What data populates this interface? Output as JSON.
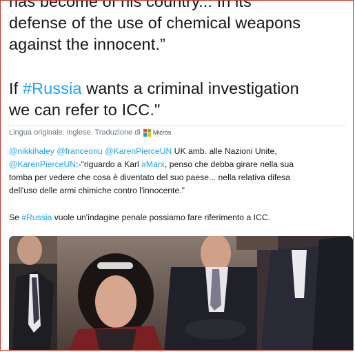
{
  "tweet": {
    "cut_line": "has become of his country... In its",
    "line1": "defense of the use of chemical weapons",
    "line2": "against the innocent.”",
    "line3_prefix": "If ",
    "line3_hashtag": "#Russia",
    "line3_suffix": " wants a criminal investigation",
    "line4": "we can refer to ICC.\""
  },
  "translation": {
    "label": "Lingua originale: inglese. Traduzione di",
    "provider": "Micros",
    "logo_colors": [
      "#f25022",
      "#7fba00",
      "#00a4ef",
      "#ffb900"
    ],
    "line1_mentions": "@nikkihaley @franceonu @KarenPierceUN",
    "line1_text": " UK amb. alle Nazioni Unite,",
    "line2_mention": "@KarenPierceUN",
    "line2_text_a": ":-\"riguardo a Karl ",
    "line2_hashtag": "#Marx",
    "line2_text_b": ", penso che debba girare nella sua",
    "line3": "tomba per vedere che cosa è diventato del suo paese... nella relativa difesa",
    "line4": "dell'uso delle armi chimiche contro l'innocente.\"",
    "line5_prefix": "Se ",
    "line5_hashtag": "#Russia",
    "line5_suffix": " vuole un'indagine penale possiamo fare riferimento a ICC."
  },
  "colors": {
    "link": "#1da1f2",
    "text": "#14171a",
    "muted": "#657786",
    "frame": "#c0392b"
  }
}
